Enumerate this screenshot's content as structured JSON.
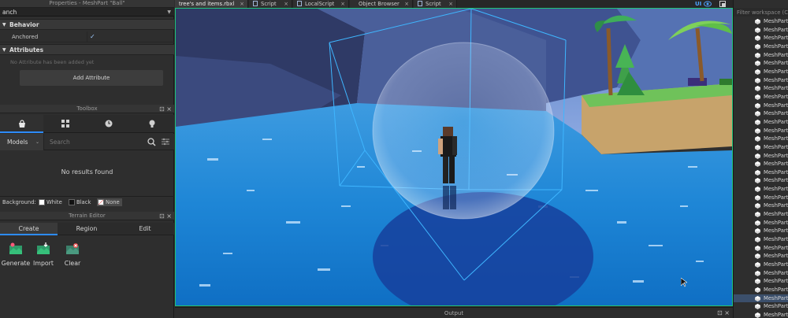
{
  "properties": {
    "title": "Properties - MeshPart \"Ball\"",
    "filter_value": "anch",
    "behavior_label": "Behavior",
    "anchored_label": "Anchored",
    "anchored_value": "✓",
    "attributes_label": "Attributes",
    "no_attr_text": "No Attribute has been added yet",
    "add_attr_label": "Add Attribute"
  },
  "toolbox": {
    "title": "Toolbox",
    "models_label": "Models",
    "search_placeholder": "Search",
    "no_results": "No results found",
    "background_label": "Background:",
    "bg_white": "White",
    "bg_black": "Black",
    "bg_none": "None"
  },
  "terrain": {
    "title": "Terrain Editor",
    "tab_create": "Create",
    "tab_region": "Region",
    "tab_edit": "Edit",
    "tool_generate": "Generate",
    "tool_import": "Import",
    "tool_clear": "Clear"
  },
  "tabs": [
    {
      "label": "tree's and items.rbxl"
    },
    {
      "label": "Script"
    },
    {
      "label": "LocalScript"
    },
    {
      "label": "Object Browser"
    },
    {
      "label": "Script"
    }
  ],
  "tab_close": "×",
  "panel_ctl": "⊡ ×",
  "ui_label": "UI",
  "output": {
    "title": "Output"
  },
  "explorer": {
    "filter_placeholder": "Filter workspace (Ctrl+Shift+X)",
    "items": [
      "MeshPart",
      "MeshPart",
      "MeshPart",
      "MeshPart",
      "MeshPart",
      "MeshPart",
      "MeshPart",
      "MeshPart",
      "MeshPart",
      "MeshPart",
      "MeshPart",
      "MeshPart",
      "MeshPart",
      "MeshPart",
      "MeshPart",
      "MeshPart",
      "MeshPart",
      "MeshPart",
      "MeshPart",
      "MeshPart",
      "MeshPart",
      "MeshPart",
      "MeshPart",
      "MeshPart",
      "MeshPart",
      "MeshPart",
      "MeshPart",
      "MeshPart",
      "MeshPart",
      "MeshPart",
      "MeshPart",
      "MeshPart",
      "MeshPart",
      "MeshPart",
      "MeshPart",
      "MeshPart",
      "MeshPart"
    ]
  },
  "colors": {
    "accent": "#2d8cff",
    "viewport_border": "#1ec27a",
    "water": "#1f7fd0",
    "selection_box": "#3fb6ff"
  }
}
